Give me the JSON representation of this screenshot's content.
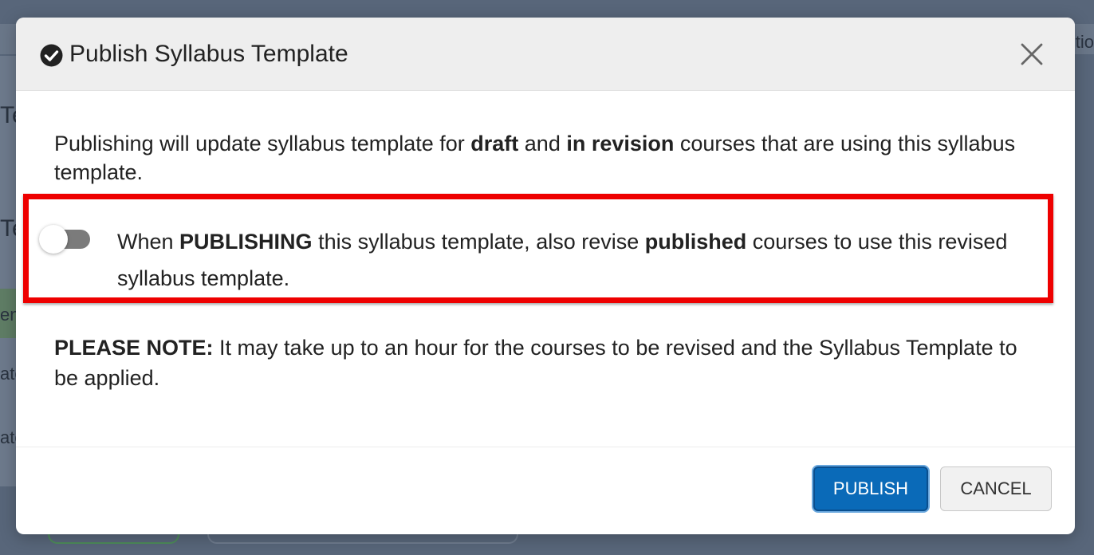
{
  "background": {
    "fragments": [
      "Te",
      "Te",
      "en",
      "ate",
      "ate",
      "ctio"
    ]
  },
  "modal": {
    "title": "Publish Syllabus Template",
    "header_icon": "check-circle-icon",
    "close_icon": "close-icon",
    "intro": {
      "part1": "Publishing will update syllabus template for ",
      "bold1": "draft",
      "part2": " and ",
      "bold2": "in revision",
      "part3": " courses that are using this syllabus template."
    },
    "toggle": {
      "state": "off",
      "text_part1": "When ",
      "bold1": "PUBLISHING",
      "text_part2": " this syllabus template, also revise ",
      "bold2": "published",
      "text_part3": " courses to use this revised syllabus template."
    },
    "note": {
      "label": "PLEASE NOTE:",
      "text": " It may take up to an hour for the courses to be revised and the Syllabus Template to be applied."
    },
    "buttons": {
      "publish": "PUBLISH",
      "cancel": "CANCEL"
    }
  },
  "colors": {
    "highlight_border": "#ee0000",
    "primary_button": "#0a6ab8",
    "header_background": "#eeeeee"
  }
}
